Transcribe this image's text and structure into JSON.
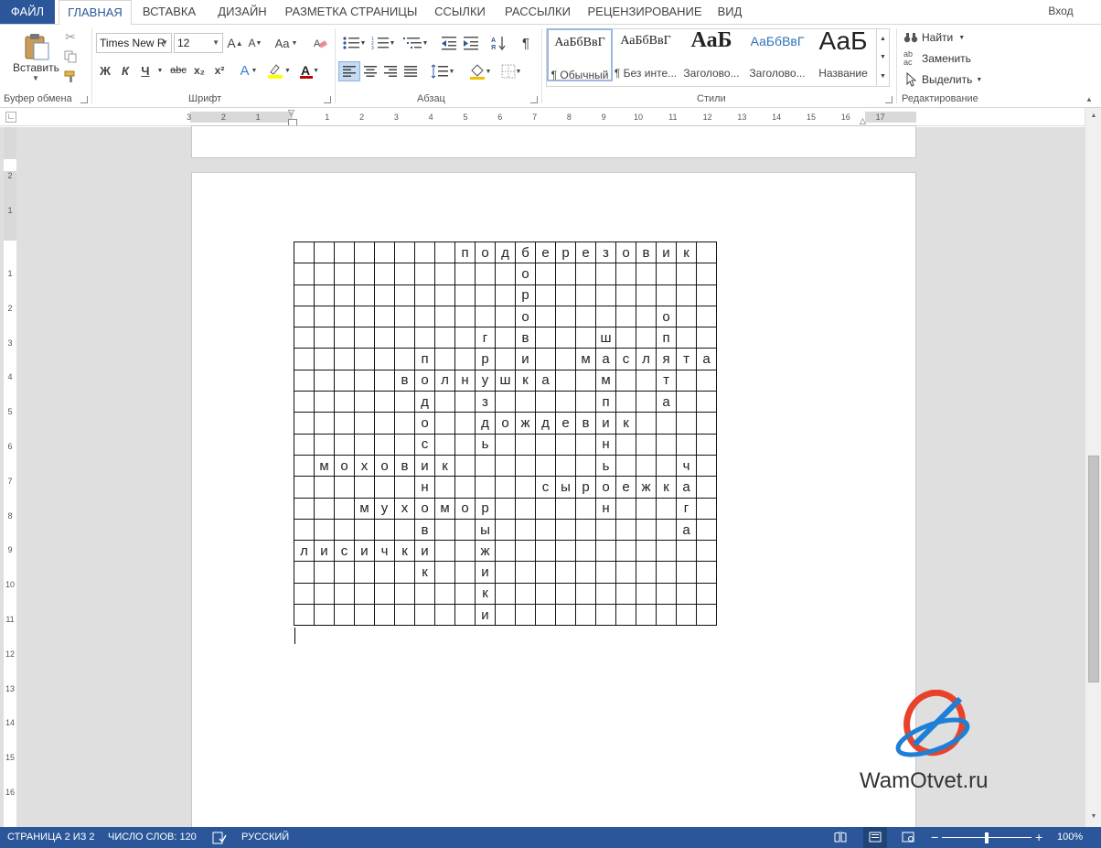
{
  "tabs": {
    "file": "ФАЙЛ",
    "home": "ГЛАВНАЯ",
    "insert": "ВСТАВКА",
    "design": "ДИЗАЙН",
    "layout": "РАЗМЕТКА СТРАНИЦЫ",
    "references": "ССЫЛКИ",
    "mailings": "РАССЫЛКИ",
    "review": "РЕЦЕНЗИРОВАНИЕ",
    "view": "ВИД",
    "signin": "Вход"
  },
  "clipboard": {
    "paste_label": "Вставить",
    "group_label": "Буфер обмена"
  },
  "font": {
    "name": "Times New R",
    "size": "12",
    "grow": "A",
    "shrink": "A",
    "case": "Aa",
    "bold": "Ж",
    "italic": "К",
    "underline": "Ч",
    "strike": "abc",
    "subscript": "x₂",
    "superscript": "x²",
    "effects": "A",
    "font_color": "A",
    "group_label": "Шрифт"
  },
  "paragraph": {
    "group_label": "Абзац"
  },
  "styles": {
    "group_label": "Стили",
    "items": [
      {
        "sample": "АаБбВвГ",
        "name": "¶ Обычный"
      },
      {
        "sample": "АаБбВвГ",
        "name": "¶ Без инте..."
      },
      {
        "sample": "АаБ",
        "name": "Заголово..."
      },
      {
        "sample": "АаБбВвГ",
        "name": "Заголово..."
      },
      {
        "sample": "АаБ",
        "name": "Название"
      }
    ]
  },
  "editing": {
    "find": "Найти",
    "replace": "Заменить",
    "select": "Выделить",
    "group_label": "Редактирование"
  },
  "ruler": {
    "h_numbers": [
      "3",
      "2",
      "1",
      "1",
      "2",
      "3",
      "4",
      "5",
      "6",
      "7",
      "8",
      "9",
      "10",
      "11",
      "12",
      "13",
      "14",
      "15",
      "16",
      "17"
    ],
    "v_numbers_top": [
      "2",
      "1"
    ],
    "v_numbers": [
      "1",
      "2",
      "3",
      "4",
      "5",
      "6",
      "7",
      "8",
      "9",
      "10",
      "11",
      "12",
      "13",
      "14",
      "15",
      "16"
    ]
  },
  "crossword": {
    "rows": [
      [
        "",
        "",
        "",
        "",
        "",
        "",
        "",
        "",
        "п",
        "о",
        "д",
        "б",
        "е",
        "р",
        "е",
        "з",
        "о",
        "в",
        "и",
        "к",
        ""
      ],
      [
        "",
        "",
        "",
        "",
        "",
        "",
        "",
        "",
        "",
        "",
        "",
        "о",
        "",
        "",
        "",
        "",
        "",
        "",
        "",
        "",
        ""
      ],
      [
        "",
        "",
        "",
        "",
        "",
        "",
        "",
        "",
        "",
        "",
        "",
        "р",
        "",
        "",
        "",
        "",
        "",
        "",
        "",
        "",
        ""
      ],
      [
        "",
        "",
        "",
        "",
        "",
        "",
        "",
        "",
        "",
        "",
        "",
        "о",
        "",
        "",
        "",
        "",
        "",
        "",
        "о",
        "",
        ""
      ],
      [
        "",
        "",
        "",
        "",
        "",
        "",
        "",
        "",
        "",
        "г",
        "",
        "в",
        "",
        "",
        "",
        "ш",
        "",
        "",
        "п",
        "",
        ""
      ],
      [
        "",
        "",
        "",
        "",
        "",
        "",
        "п",
        "",
        "",
        "р",
        "",
        "и",
        "",
        "",
        "м",
        "а",
        "с",
        "л",
        "я",
        "т",
        "а"
      ],
      [
        "",
        "",
        "",
        "",
        "",
        "в",
        "о",
        "л",
        "н",
        "у",
        "ш",
        "к",
        "а",
        "",
        "",
        "м",
        "",
        "",
        "т",
        "",
        ""
      ],
      [
        "",
        "",
        "",
        "",
        "",
        "",
        "д",
        "",
        "",
        "з",
        "",
        "",
        "",
        "",
        "",
        "п",
        "",
        "",
        "а",
        "",
        ""
      ],
      [
        "",
        "",
        "",
        "",
        "",
        "",
        "о",
        "",
        "",
        "д",
        "о",
        "ж",
        "д",
        "е",
        "в",
        "и",
        "к",
        "",
        "",
        "",
        ""
      ],
      [
        "",
        "",
        "",
        "",
        "",
        "",
        "с",
        "",
        "",
        "ь",
        "",
        "",
        "",
        "",
        "",
        "н",
        "",
        "",
        "",
        "",
        ""
      ],
      [
        "",
        "м",
        "о",
        "х",
        "о",
        "в",
        "и",
        "к",
        "",
        "",
        "",
        "",
        "",
        "",
        "",
        "ь",
        "",
        "",
        "",
        "ч",
        ""
      ],
      [
        "",
        "",
        "",
        "",
        "",
        "",
        "н",
        "",
        "",
        "",
        "",
        "",
        "с",
        "ы",
        "р",
        "о",
        "е",
        "ж",
        "к",
        "а",
        ""
      ],
      [
        "",
        "",
        "",
        "м",
        "у",
        "х",
        "о",
        "м",
        "о",
        "р",
        "",
        "",
        "",
        "",
        "",
        "н",
        "",
        "",
        "",
        "г",
        ""
      ],
      [
        "",
        "",
        "",
        "",
        "",
        "",
        "в",
        "",
        "",
        "ы",
        "",
        "",
        "",
        "",
        "",
        "",
        "",
        "",
        "",
        "а",
        ""
      ],
      [
        "л",
        "и",
        "с",
        "и",
        "ч",
        "к",
        "и",
        "",
        "",
        "ж",
        "",
        "",
        "",
        "",
        "",
        "",
        "",
        "",
        "",
        "",
        ""
      ],
      [
        "",
        "",
        "",
        "",
        "",
        "",
        "к",
        "",
        "",
        "и",
        "",
        "",
        "",
        "",
        "",
        "",
        "",
        "",
        "",
        "",
        ""
      ],
      [
        "",
        "",
        "",
        "",
        "",
        "",
        "",
        "",
        "",
        "к",
        "",
        "",
        "",
        "",
        "",
        "",
        "",
        "",
        "",
        "",
        ""
      ],
      [
        "",
        "",
        "",
        "",
        "",
        "",
        "",
        "",
        "",
        "и",
        "",
        "",
        "",
        "",
        "",
        "",
        "",
        "",
        "",
        "",
        ""
      ]
    ]
  },
  "watermark": {
    "text": "WamOtvet.ru"
  },
  "status": {
    "page": "СТРАНИЦА 2 ИЗ 2",
    "words": "ЧИСЛО СЛОВ: 120",
    "language": "РУССКИЙ",
    "zoom": "100%",
    "zoom_minus": "−",
    "zoom_plus": "+"
  },
  "colors": {
    "accent": "#2b579a",
    "watermark_red": "#e8432a",
    "watermark_blue": "#1e7fd6"
  }
}
